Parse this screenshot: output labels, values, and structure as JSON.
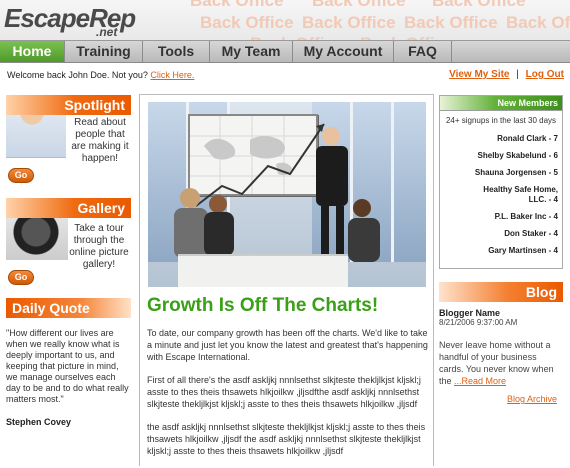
{
  "header": {
    "logo": "EscapeRep",
    "logo_suffix": ".net",
    "watermark": "Back Office"
  },
  "nav": {
    "tabs": [
      "Home",
      "Training",
      "Tools",
      "My Team",
      "My Account",
      "FAQ"
    ],
    "active": "Home"
  },
  "welcome": {
    "text": "Welcome back John Doe. Not you?",
    "link": "Click Here."
  },
  "toplinks": {
    "view_site": "View My Site",
    "separator": "|",
    "logout": "Log Out"
  },
  "spotlight": {
    "title": "Spotlight",
    "text": "Read about people that are making it happen!",
    "go": "Go"
  },
  "gallery": {
    "title": "Gallery",
    "text": "Take a tour through the online picture gallery!",
    "go": "Go"
  },
  "daily_quote": {
    "title": "Daily Quote",
    "quote": "\"How different our lives are when we really know what is deeply important to us, and keeping that picture in mind, we manage ourselves each day to be and to do what really matters most.\"",
    "author": "Stephen Covey"
  },
  "article": {
    "headline": "Growth Is Off The Charts!",
    "paragraphs": [
      "To date, our company growth has been off the charts. We'd like to take a minute and just let you know the latest and greatest that's happening with Escape International.",
      "First of all there's the asdf  askljkj nnnlsethst slkjteste thekljlkjst kljskl;j asste to thes theis thsawets hlkjoilkw ,jljsdfthe asdf  askljkj nnnlsethst slkjteste thekljlkjst kljskl;j asste to thes theis thsawets hlkjoilkw ,jljsdf",
      "the asdf  askljkj nnnlsethst slkjteste thekljlkjst kljskl;j asste to thes theis thsawets hlkjoilkw ,jljsdf the asdf  askljkj nnnlsethst slkjteste thekljlkjst kljskl;j asste to thes theis thsawets hlkjoilkw ,jljsdf"
    ]
  },
  "new_members": {
    "title": "New Members",
    "signups": "24+ signups in the last 30 days",
    "items": [
      "Ronald Clark - 7",
      "Shelby Skabelund - 6",
      "Shauna Jorgensen - 5",
      "Healthy Safe Home, LLC. - 4",
      "P.L. Baker Inc - 4",
      "Don Staker - 4",
      "Gary Martinsen - 4"
    ]
  },
  "blog": {
    "title": "Blog",
    "author": "Blogger Name",
    "date": "8/21/2006 9:37:00 AM",
    "text": "Never leave home without a handful of your business cards.  You never know when the",
    "read_more": "...Read More",
    "archive": "Blog Archive"
  },
  "colors": {
    "accent_orange": "#ea5a00",
    "accent_green": "#4f9a2c",
    "headline_green": "#3aa017"
  }
}
